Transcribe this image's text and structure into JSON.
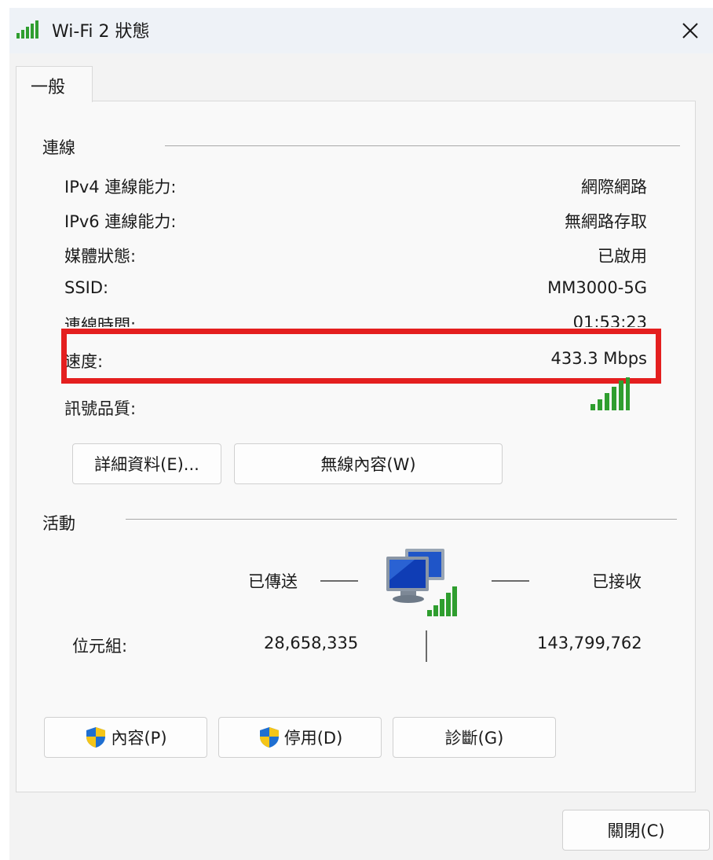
{
  "window": {
    "title": "Wi-Fi 2 狀態"
  },
  "tabs": [
    {
      "label": "一般"
    }
  ],
  "connection": {
    "group_label": "連線",
    "rows": [
      {
        "label": "IPv4 連線能力:",
        "value": "網際網路"
      },
      {
        "label": "IPv6 連線能力:",
        "value": "無網路存取"
      },
      {
        "label": "媒體狀態:",
        "value": "已啟用"
      },
      {
        "label": "SSID:",
        "value": "MM3000-5G"
      },
      {
        "label": "連線時間:",
        "value": "01:53:23"
      },
      {
        "label": "速度:",
        "value": "433.3 Mbps"
      }
    ],
    "signal_label": "訊號品質:",
    "signal_icon": "signal-strength-icon",
    "details_button": "詳細資料(E)...",
    "wireless_button": "無線內容(W)"
  },
  "activity": {
    "group_label": "活動",
    "sent_label": "已傳送",
    "received_label": "已接收",
    "bytes_label": "位元組:",
    "bytes_sent": "28,658,335",
    "bytes_received": "143,799,762",
    "network_icon": "network-computers-icon"
  },
  "buttons": {
    "properties": "內容(P)",
    "disable": "停用(D)",
    "diagnose": "診斷(G)",
    "close": "關閉(C)"
  },
  "colors": {
    "highlight": "#e41f1f",
    "signal": "#2f9e2f",
    "shield_blue": "#1f6fd1",
    "shield_yellow": "#f5c518"
  }
}
